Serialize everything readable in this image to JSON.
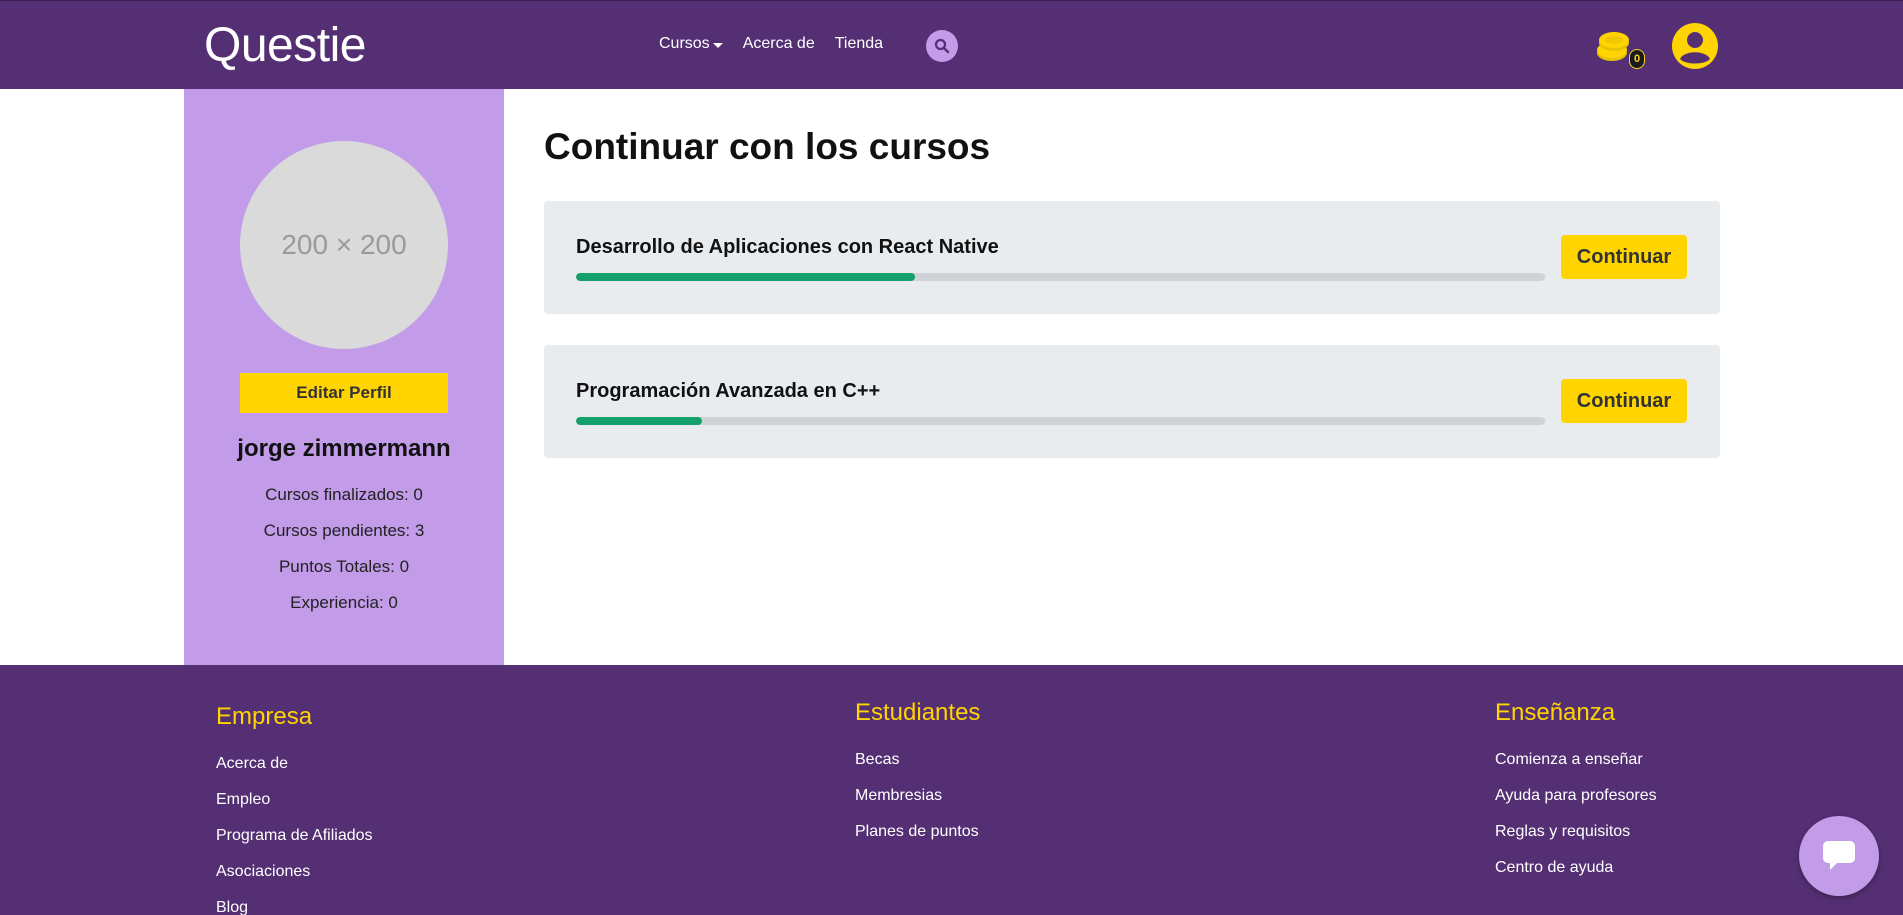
{
  "header": {
    "logo": "Questie",
    "nav": [
      {
        "label": "Cursos",
        "has_dropdown": true
      },
      {
        "label": "Acerca de"
      },
      {
        "label": "Tienda"
      }
    ],
    "coins_count": "0",
    "search_icon": "search-icon",
    "user_icon": "user-circle-icon",
    "coins_icon": "coins-icon"
  },
  "profile": {
    "avatar_placeholder": "200 × 200",
    "edit_button": "Editar Perfil",
    "name": "jorge zimmermann",
    "stats": [
      "Cursos finalizados: 0",
      "Cursos pendientes: 3",
      "Puntos Totales: 0",
      "Experiencia: 0"
    ]
  },
  "main": {
    "title": "Continuar con los cursos",
    "courses": [
      {
        "title": "Desarrollo de Aplicaciones con React Native",
        "progress": 0.35,
        "button": "Continuar"
      },
      {
        "title": "Programación Avanzada en C++",
        "progress": 0.13,
        "button": "Continuar"
      }
    ]
  },
  "footer": {
    "columns": [
      {
        "heading": "Empresa",
        "links": [
          "Acerca de",
          "Empleo",
          "Programa de Afiliados",
          "Asociaciones",
          "Blog"
        ]
      },
      {
        "heading": "Estudiantes",
        "links": [
          "Becas",
          "Membresias",
          "Planes de puntos"
        ]
      },
      {
        "heading": "Enseñanza",
        "links": [
          "Comienza a enseñar",
          "Ayuda para profesores",
          "Reglas y requisitos",
          "Centro de ayuda"
        ]
      }
    ],
    "chat_icon": "chat-bubble-icon"
  },
  "colors": {
    "primary": "#552f73",
    "sidebar": "#c29be9",
    "accent": "#ffd400",
    "progress": "#13a06b"
  }
}
